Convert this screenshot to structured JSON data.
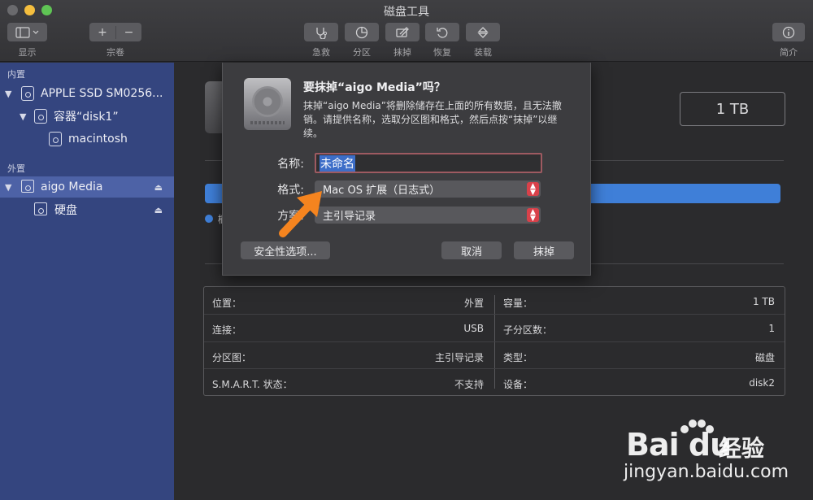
{
  "window": {
    "title": "磁盘工具"
  },
  "toolbar": {
    "view_label": "显示",
    "volume_label": "宗卷",
    "firstaid_label": "急救",
    "partition_label": "分区",
    "erase_label": "抹掉",
    "restore_label": "恢复",
    "mount_label": "装载",
    "info_label": "简介"
  },
  "sidebar": {
    "internal_header": "内置",
    "external_header": "外置",
    "items": [
      {
        "label": "APPLE SSD SM0256..."
      },
      {
        "label": "容器“disk1”"
      },
      {
        "label": "macintosh"
      },
      {
        "label": "aigo Media"
      },
      {
        "label": "硬盘"
      }
    ]
  },
  "main": {
    "capacity": "1 TB",
    "radio_char": "櫛",
    "info": {
      "left": [
        {
          "key": "位置：",
          "value": "外置"
        },
        {
          "key": "连接：",
          "value": "USB"
        },
        {
          "key": "分区图：",
          "value": "主引导记录"
        },
        {
          "key": "S.M.A.R.T. 状态：",
          "value": "不支持"
        }
      ],
      "right": [
        {
          "key": "容量：",
          "value": "1 TB"
        },
        {
          "key": "子分区数：",
          "value": "1"
        },
        {
          "key": "类型：",
          "value": "磁盘"
        },
        {
          "key": "设备：",
          "value": "disk2"
        }
      ]
    }
  },
  "dialog": {
    "title": "要抹掉“aigo Media”吗？",
    "description": "抹掉“aigo Media”将删除储存在上面的所有数据，且无法撤销。请提供名称，选取分区图和格式，然后点按“抹掉”以继续。",
    "name_label": "名称:",
    "name_value": "未命名",
    "format_label": "格式:",
    "format_value": "Mac OS 扩展（日志式）",
    "scheme_label": "方案:",
    "scheme_value": "主引导记录",
    "security_button": "安全性选项...",
    "cancel_button": "取消",
    "erase_button": "抹掉"
  },
  "watermark": {
    "logo": "Bai du",
    "jingyan": "经验",
    "url": "jingyan.baidu.com"
  },
  "colors": {
    "sidebar_bg": "#34457f",
    "sidebar_selected": "#4d62a6",
    "accent_blue": "#3f7fd8",
    "select_arrow": "#d8414a",
    "annotation_arrow": "#f5841f"
  }
}
